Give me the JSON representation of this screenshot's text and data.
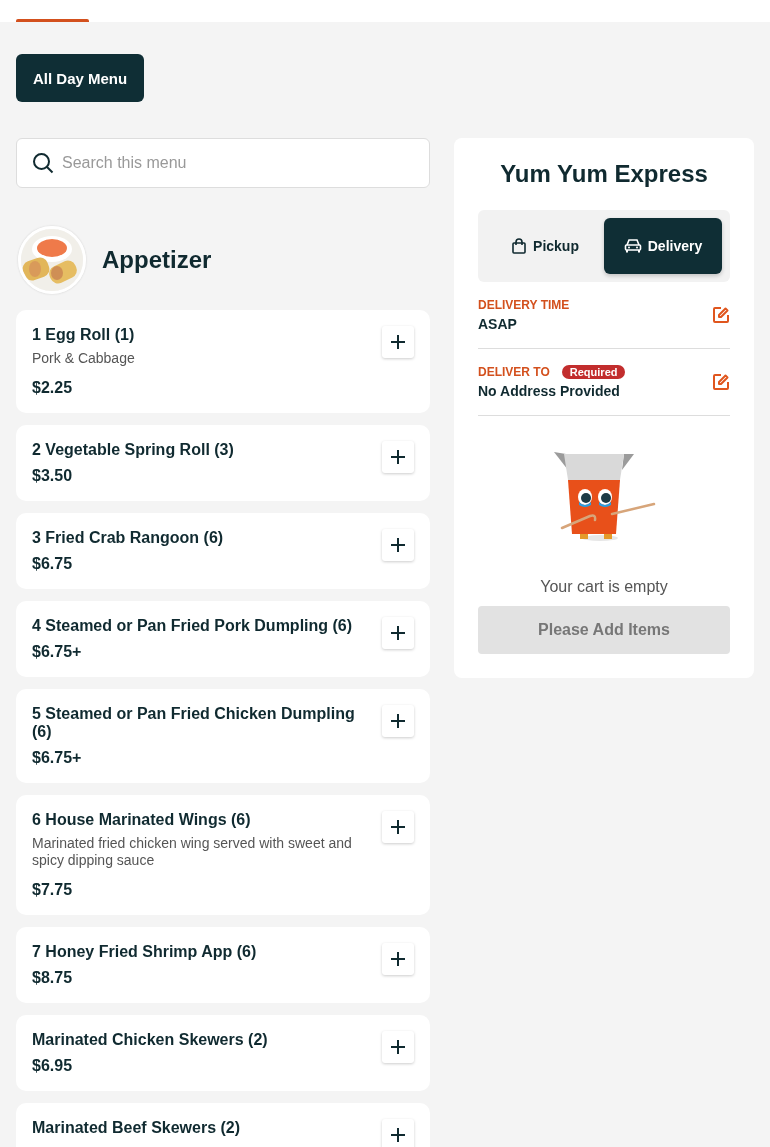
{
  "menu_button": {
    "label": "All Day Menu"
  },
  "search": {
    "placeholder": "Search this menu"
  },
  "category": {
    "title": "Appetizer"
  },
  "items": [
    {
      "name": "1 Egg Roll (1)",
      "description": "Pork & Cabbage",
      "price": "$2.25"
    },
    {
      "name": "2 Vegetable Spring Roll (3)",
      "price": "$3.50"
    },
    {
      "name": "3 Fried Crab Rangoon (6)",
      "price": "$6.75"
    },
    {
      "name": "4 Steamed or Pan Fried Pork Dumpling (6)",
      "price": "$6.75+"
    },
    {
      "name": "5 Steamed or Pan Fried Chicken Dumpling (6)",
      "price": "$6.75+"
    },
    {
      "name": "6 House Marinated Wings (6)",
      "description": "Marinated fried chicken wing served with sweet and spicy dipping sauce",
      "price": "$7.75"
    },
    {
      "name": "7 Honey Fried Shrimp App (6)",
      "price": "$8.75"
    },
    {
      "name": "Marinated Chicken Skewers (2)",
      "price": "$6.95"
    },
    {
      "name": "Marinated Beef Skewers (2)"
    }
  ],
  "cart": {
    "restaurant": "Yum Yum Express",
    "modes": [
      {
        "label": "Pickup",
        "kind": "pickup",
        "selected": false
      },
      {
        "label": "Delivery",
        "kind": "delivery",
        "selected": true
      }
    ],
    "details": [
      {
        "label": "DELIVERY TIME",
        "value": "ASAP"
      },
      {
        "label": "DELIVER TO",
        "badge": "Required",
        "value": "No Address Provided"
      }
    ],
    "empty_message": "Your cart is empty",
    "checkout_button": {
      "label": "Please Add Items",
      "disabled": true
    }
  }
}
